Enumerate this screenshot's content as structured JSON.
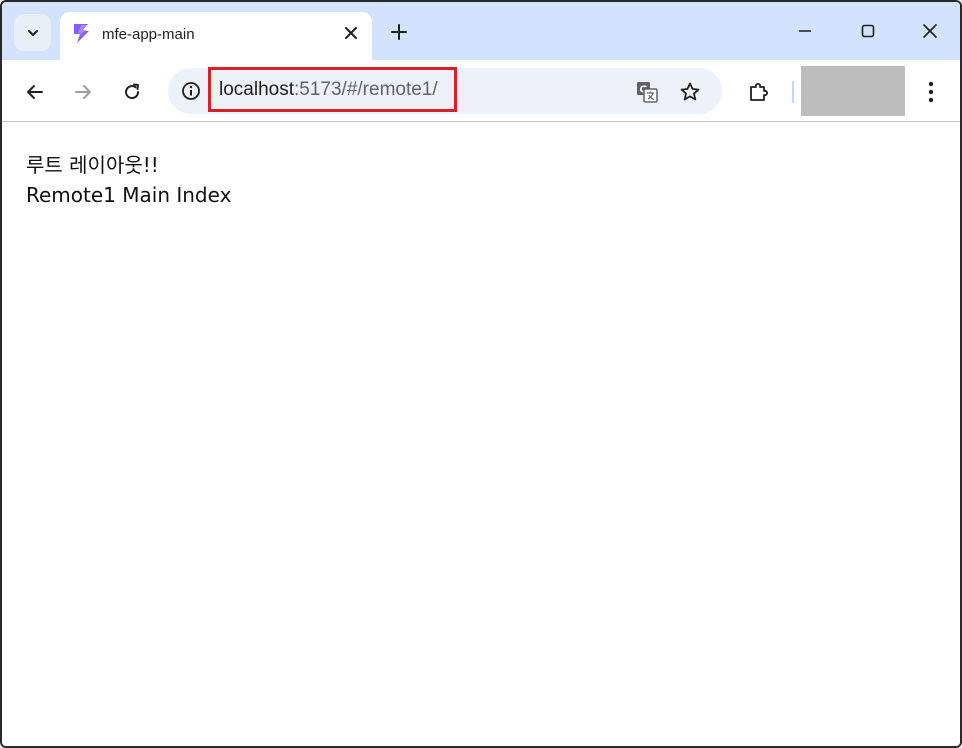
{
  "browser": {
    "tab": {
      "title": "mfe-app-main",
      "favicon": "lightning-bolt-icon"
    },
    "address_bar": {
      "host": "localhost",
      "path": ":5173/#/remote1/"
    },
    "icons": {
      "tab_search": "chevron-down-icon",
      "close_tab": "close-icon",
      "new_tab": "plus-icon",
      "minimize": "minimize-icon",
      "maximize": "maximize-icon",
      "close_window": "close-icon",
      "back": "back-arrow-icon",
      "forward": "forward-arrow-icon",
      "reload": "reload-icon",
      "site_info": "info-icon",
      "translate": "translate-icon",
      "bookmark": "star-icon",
      "extensions": "puzzle-icon",
      "menu": "kebab-menu-icon"
    },
    "colors": {
      "tabstrip": "#d3e3fd",
      "omnibox": "#edf2fa",
      "highlight": "#d8202a",
      "favicon": "#8b5cf6"
    }
  },
  "page": {
    "layout_title": "루트 레이아웃!!",
    "index_text": "Remote1 Main Index"
  }
}
